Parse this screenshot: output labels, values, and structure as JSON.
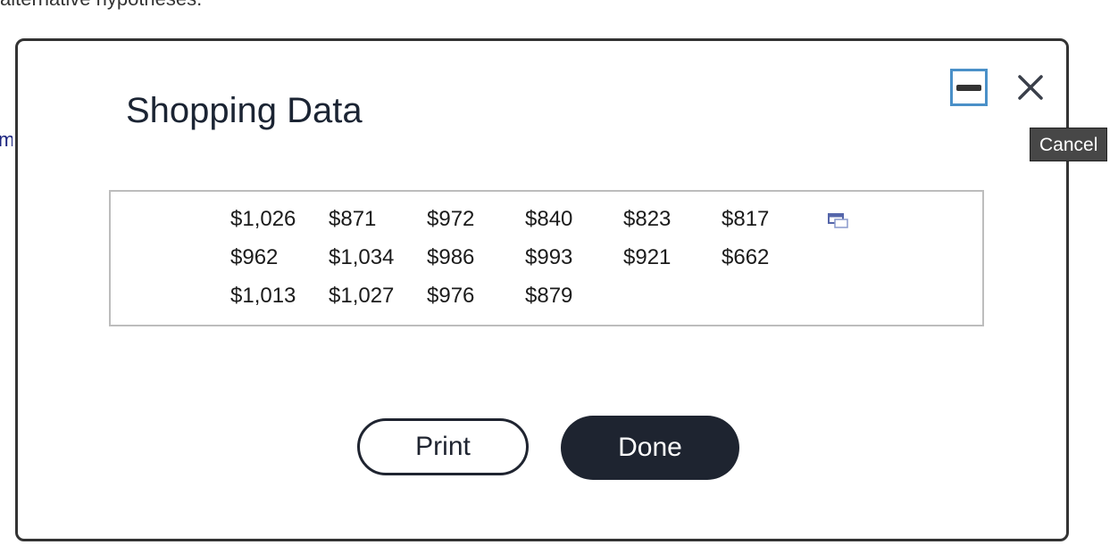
{
  "background": {
    "top_text": "alternative hypotheses.",
    "left_link": "ma"
  },
  "dialog": {
    "title": "Shopping Data",
    "tooltip": "Cancel",
    "minimize_icon": "minimize-icon",
    "close_icon": "close-icon",
    "copy_icon": "copy-icon",
    "rows": [
      [
        "$1,026",
        "$871",
        "$972",
        "$840",
        "$823",
        "$817"
      ],
      [
        "$962",
        "$1,034",
        "$986",
        "$993",
        "$921",
        "$662"
      ],
      [
        "$1,013",
        "$1,027",
        "$976",
        "$879",
        "",
        ""
      ]
    ],
    "print_label": "Print",
    "done_label": "Done"
  },
  "colors": {
    "accent_border": "#4a90c8",
    "primary_button": "#1e2430",
    "tooltip_bg": "#474747",
    "copy_icon": "#5566aa"
  }
}
